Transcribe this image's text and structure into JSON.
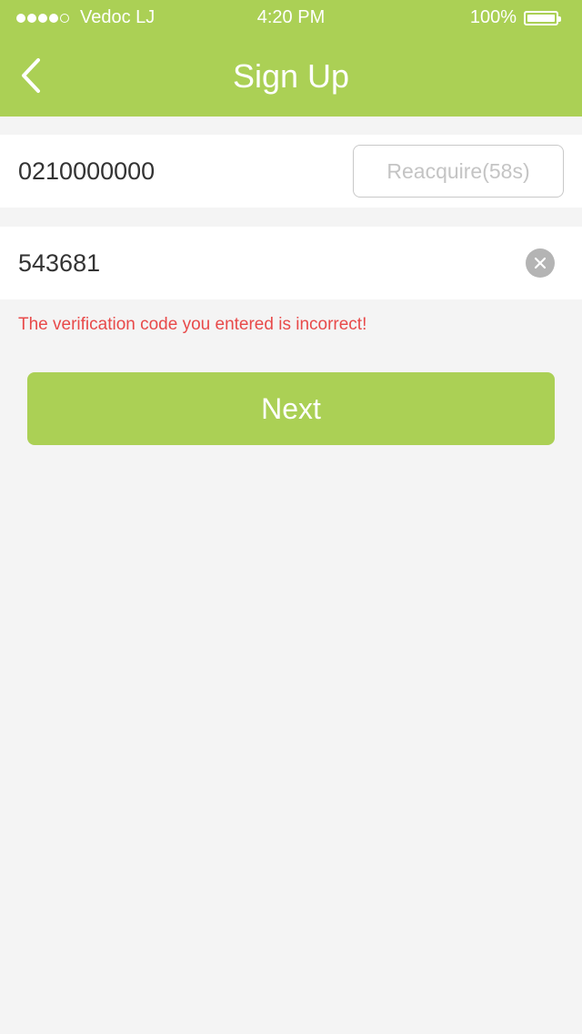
{
  "status_bar": {
    "carrier": "Vedoc LJ",
    "time": "4:20 PM",
    "battery_percent": "100%",
    "signal_bars_filled": 4,
    "signal_bars_total": 5
  },
  "nav": {
    "back_icon": "chevron-left-icon",
    "title": "Sign Up"
  },
  "form": {
    "phone_value": "0210000000",
    "reacquire_label": "Reacquire(58s)",
    "code_value": "543681",
    "clear_icon": "clear-icon",
    "error_message": "The verification code you entered is incorrect!"
  },
  "next_button": {
    "label": "Next"
  },
  "colors": {
    "accent": "#abd055",
    "background": "#f4f4f4",
    "error": "#e84a4a"
  }
}
